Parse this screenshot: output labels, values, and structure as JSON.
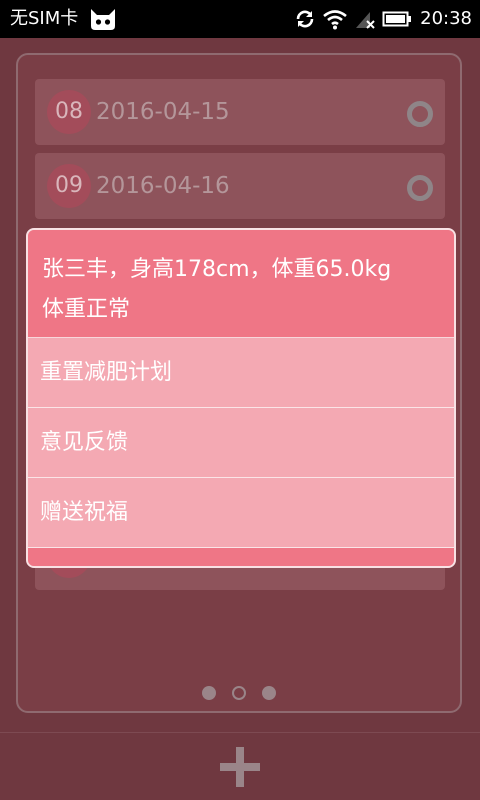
{
  "status_bar": {
    "carrier": "无SIM卡",
    "time": "20:38",
    "icons": [
      "cyanogen-cat-icon",
      "sync-icon",
      "wifi-icon",
      "signal-none-icon",
      "battery-icon"
    ]
  },
  "list": {
    "rows": [
      {
        "badge": "08",
        "date": "2016-04-15"
      },
      {
        "badge": "09",
        "date": "2016-04-16"
      }
    ]
  },
  "popup": {
    "profile": "张三丰，身高178cm，体重65.0kg",
    "status": "体重正常",
    "items": [
      {
        "label": "重置减肥计划"
      },
      {
        "label": "意见反馈"
      },
      {
        "label": "赠送祝福"
      }
    ]
  },
  "pager": {
    "count": 3,
    "current": 2
  },
  "colors": {
    "background": "#6f3840",
    "popup_header": "#ef7686",
    "popup_body": "#f4a9b3"
  }
}
